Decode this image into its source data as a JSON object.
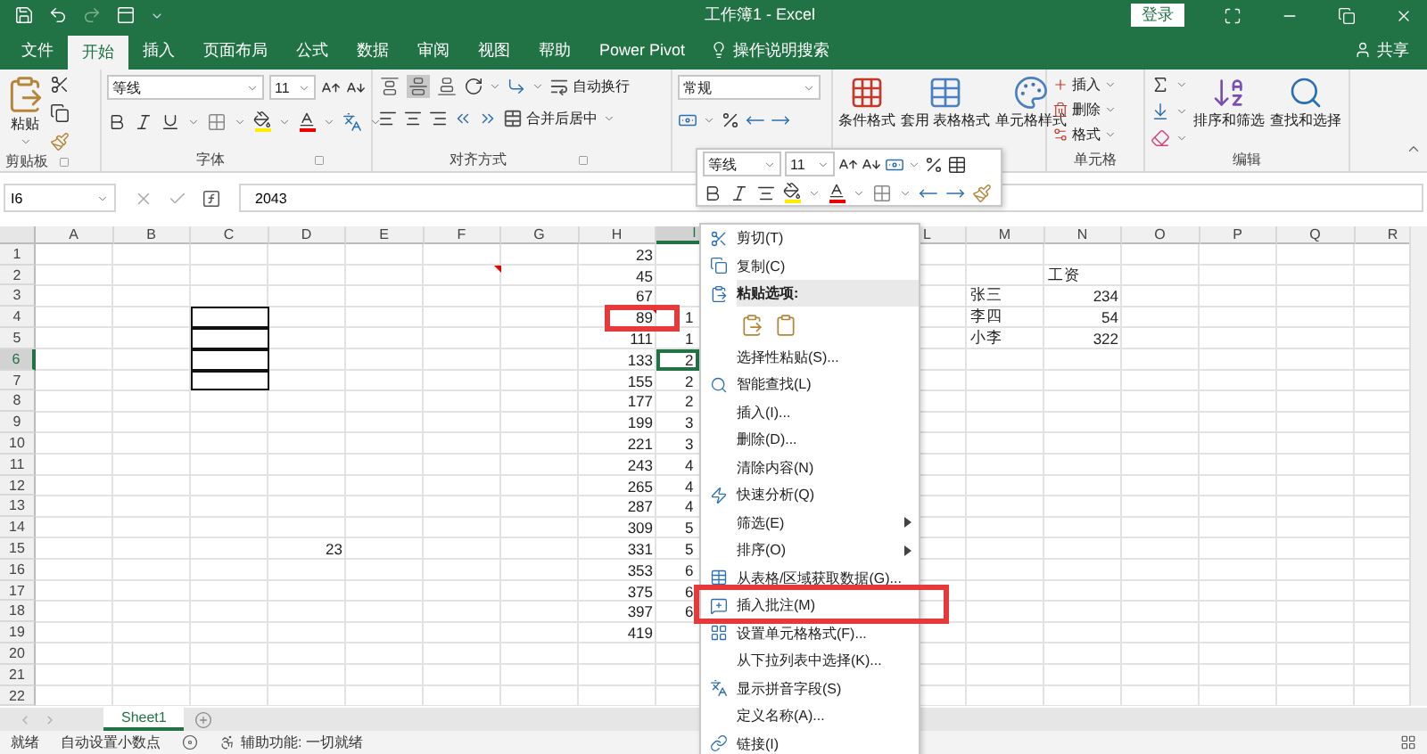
{
  "title_bar": {
    "title": "工作簿1 - Excel",
    "sign_in": "登录"
  },
  "tabs": [
    {
      "label": "文件",
      "selected": false
    },
    {
      "label": "开始",
      "selected": true
    },
    {
      "label": "插入",
      "selected": false
    },
    {
      "label": "页面布局",
      "selected": false
    },
    {
      "label": "公式",
      "selected": false
    },
    {
      "label": "数据",
      "selected": false
    },
    {
      "label": "审阅",
      "selected": false
    },
    {
      "label": "视图",
      "selected": false
    },
    {
      "label": "帮助",
      "selected": false
    },
    {
      "label": "Power Pivot",
      "selected": false
    }
  ],
  "tell_me": "操作说明搜索",
  "share": "共享",
  "ribbon": {
    "clipboard": {
      "paste": "粘贴",
      "label": "剪贴板"
    },
    "font": {
      "name": "等线",
      "size": "11",
      "label": "字体"
    },
    "alignment": {
      "vertical_align": [
        {
          "selected": false
        },
        {
          "selected": true
        },
        {
          "selected": false
        }
      ],
      "wrap": "自动换行",
      "merge": "合并后居中",
      "label": "对齐方式"
    },
    "number": {
      "format": "常规"
    },
    "styles": {
      "conditional": "条件格式",
      "table": [
        "套用",
        "表格格式"
      ],
      "cell_styles": "单元格样式"
    },
    "cells": {
      "buttons": [
        "插入",
        "删除",
        "格式"
      ],
      "label": "单元格"
    },
    "editing": {
      "sort": "排序和筛选",
      "find": "查找和选择",
      "label": "编辑"
    }
  },
  "formula_bar": {
    "name_box": "I6",
    "value": "2043"
  },
  "mini_toolbar": {
    "font": "等线",
    "size": "11"
  },
  "sheet": {
    "columns": [
      {
        "label": "A",
        "selected": false
      },
      {
        "label": "B",
        "selected": false
      },
      {
        "label": "C",
        "selected": false
      },
      {
        "label": "D",
        "selected": false
      },
      {
        "label": "E",
        "selected": false
      },
      {
        "label": "F",
        "selected": false
      },
      {
        "label": "G",
        "selected": false
      },
      {
        "label": "H",
        "selected": false
      },
      {
        "label": "I",
        "selected": true,
        "clipped": true
      },
      {
        "label": "L",
        "selected": false,
        "gap_before": true
      },
      {
        "label": "M",
        "selected": false
      },
      {
        "label": "N",
        "selected": false
      },
      {
        "label": "O",
        "selected": false
      },
      {
        "label": "P",
        "selected": false
      },
      {
        "label": "Q",
        "selected": false
      },
      {
        "label": "R",
        "selected": false
      }
    ],
    "rows": [
      {
        "label": "1",
        "selected": false,
        "cells": {
          "H": "23"
        }
      },
      {
        "label": "2",
        "selected": false,
        "cells": {
          "H": "45",
          "N": "工资"
        },
        "comment": {
          "F": true
        }
      },
      {
        "label": "3",
        "selected": false,
        "cells": {
          "H": "67",
          "M": "张三",
          "N": "234"
        }
      },
      {
        "label": "4",
        "selected": false,
        "cells": {
          "H": "89",
          "I": "1",
          "M": "李四",
          "N": "54"
        },
        "bordered": {
          "C": true
        },
        "comment": {
          "H": true
        }
      },
      {
        "label": "5",
        "selected": false,
        "cells": {
          "H": "111",
          "I": "1",
          "M": "小李",
          "N": "322"
        },
        "bordered": {
          "C": true
        }
      },
      {
        "label": "6",
        "selected": true,
        "cells": {
          "H": "133",
          "I": "2"
        },
        "bordered": {
          "C": true
        }
      },
      {
        "label": "7",
        "selected": false,
        "cells": {
          "H": "155",
          "I": "2"
        },
        "bordered": {
          "C": true
        }
      },
      {
        "label": "8",
        "selected": false,
        "cells": {
          "H": "177",
          "I": "2"
        }
      },
      {
        "label": "9",
        "selected": false,
        "cells": {
          "H": "199",
          "I": "3"
        }
      },
      {
        "label": "10",
        "selected": false,
        "cells": {
          "H": "221",
          "I": "3"
        }
      },
      {
        "label": "11",
        "selected": false,
        "cells": {
          "H": "243",
          "I": "4"
        }
      },
      {
        "label": "12",
        "selected": false,
        "cells": {
          "H": "265",
          "I": "4"
        }
      },
      {
        "label": "13",
        "selected": false,
        "cells": {
          "H": "287",
          "I": "4"
        }
      },
      {
        "label": "14",
        "selected": false,
        "cells": {
          "H": "309",
          "I": "5"
        }
      },
      {
        "label": "15",
        "selected": false,
        "cells": {
          "D": "23",
          "H": "331",
          "I": "5"
        }
      },
      {
        "label": "16",
        "selected": false,
        "cells": {
          "H": "353",
          "I": "6"
        }
      },
      {
        "label": "17",
        "selected": false,
        "cells": {
          "H": "375",
          "I": "6"
        }
      },
      {
        "label": "18",
        "selected": false,
        "cells": {
          "H": "397",
          "I": "6"
        }
      },
      {
        "label": "19",
        "selected": false,
        "cells": {
          "H": "419"
        }
      },
      {
        "label": "20",
        "selected": false
      },
      {
        "label": "21",
        "selected": false
      },
      {
        "label": "22",
        "selected": false
      }
    ]
  },
  "context_menu": [
    {
      "kind": "item",
      "label": "剪切(T)",
      "submenu": false
    },
    {
      "kind": "item",
      "label": "复制(C)",
      "submenu": false
    },
    {
      "kind": "header",
      "label": "粘贴选项:"
    },
    {
      "kind": "paste_options"
    },
    {
      "kind": "item",
      "label": "选择性粘贴(S)...",
      "submenu": false
    },
    {
      "kind": "item",
      "label": "智能查找(L)",
      "submenu": false
    },
    {
      "kind": "item",
      "label": "插入(I)...",
      "submenu": false
    },
    {
      "kind": "item",
      "label": "删除(D)...",
      "submenu": false
    },
    {
      "kind": "item",
      "label": "清除内容(N)",
      "submenu": false
    },
    {
      "kind": "item",
      "label": "快速分析(Q)",
      "submenu": false
    },
    {
      "kind": "item",
      "label": "筛选(E)",
      "submenu": true
    },
    {
      "kind": "item",
      "label": "排序(O)",
      "submenu": true
    },
    {
      "kind": "item",
      "label": "从表格/区域获取数据(G)...",
      "submenu": false
    },
    {
      "kind": "item",
      "label": "插入批注(M)",
      "submenu": false
    },
    {
      "kind": "item",
      "label": "设置单元格格式(F)...",
      "submenu": false
    },
    {
      "kind": "item",
      "label": "从下拉列表中选择(K)...",
      "submenu": false
    },
    {
      "kind": "item",
      "label": "显示拼音字段(S)",
      "submenu": false
    },
    {
      "kind": "item",
      "label": "定义名称(A)...",
      "submenu": false
    },
    {
      "kind": "item",
      "label": "链接(I)",
      "submenu": false
    }
  ],
  "sheet_tabs": [
    {
      "label": "Sheet1",
      "selected": true
    }
  ],
  "status_bar": {
    "ready": "就绪",
    "decimal": "自动设置小数点",
    "accessibility": "辅助功能: 一切就绪"
  }
}
